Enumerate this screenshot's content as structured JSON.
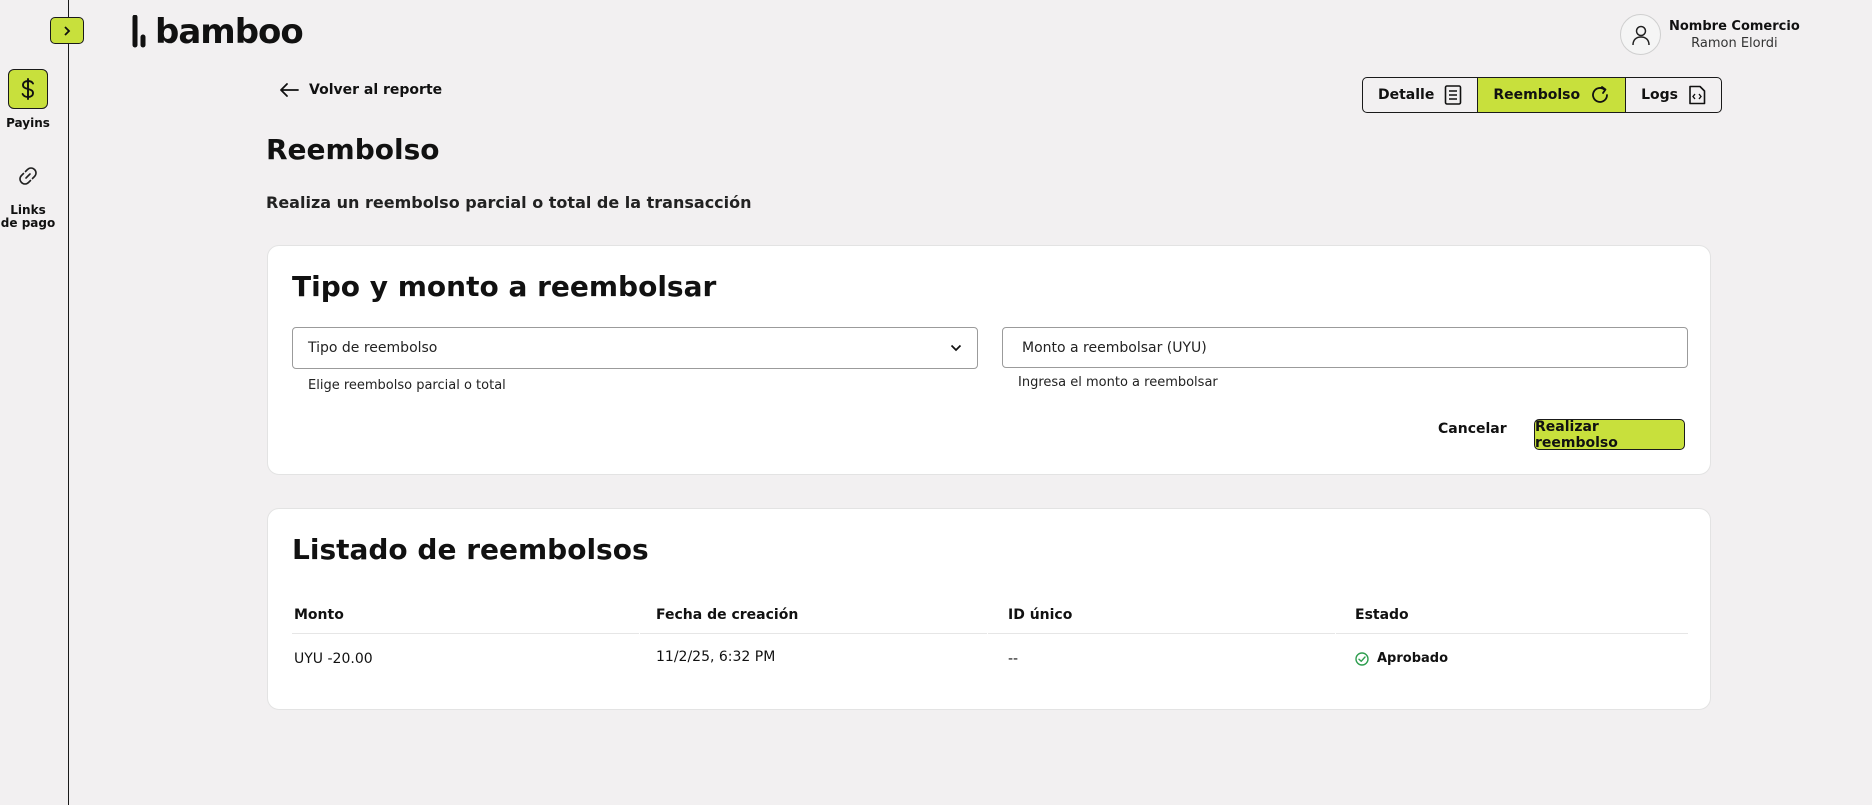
{
  "brand": {
    "name": "bamboo",
    "accent": "#c8e03c"
  },
  "sidebar": {
    "items": [
      {
        "label": "Payins",
        "icon": "dollar-icon",
        "active": true
      },
      {
        "label": "Links de pago",
        "icon": "link-icon",
        "active": false
      }
    ]
  },
  "user": {
    "name": "Nombre Comercio",
    "subtitle": "Ramon Elordi"
  },
  "header": {
    "back_label": "Volver al reporte",
    "tabs": [
      {
        "label": "Detalle",
        "icon": "document-icon",
        "active": false
      },
      {
        "label": "Reembolso",
        "icon": "refresh-icon",
        "active": true
      },
      {
        "label": "Logs",
        "icon": "code-file-icon",
        "active": false
      }
    ]
  },
  "page": {
    "title": "Reembolso",
    "subtitle": "Realiza un reembolso parcial o total de la transacción"
  },
  "refund_form": {
    "title": "Tipo y monto a reembolsar",
    "type_select": {
      "value": "Tipo de reembolso",
      "helper": "Elige reembolso parcial o total"
    },
    "amount_input": {
      "placeholder": "Monto a reembolsar (UYU)",
      "helper": "Ingresa el monto a reembolsar"
    },
    "cancel_label": "Cancelar",
    "submit_label": "Realizar reembolso"
  },
  "refund_list": {
    "title": "Listado de reembolsos",
    "columns": [
      "Monto",
      "Fecha de creación",
      "ID único",
      "Estado"
    ],
    "rows": [
      {
        "amount": "UYU -20.00",
        "date": "11/2/25, 6:32 PM",
        "id": "--",
        "status": "Aprobado",
        "status_color": "#2e9e4f"
      }
    ]
  }
}
